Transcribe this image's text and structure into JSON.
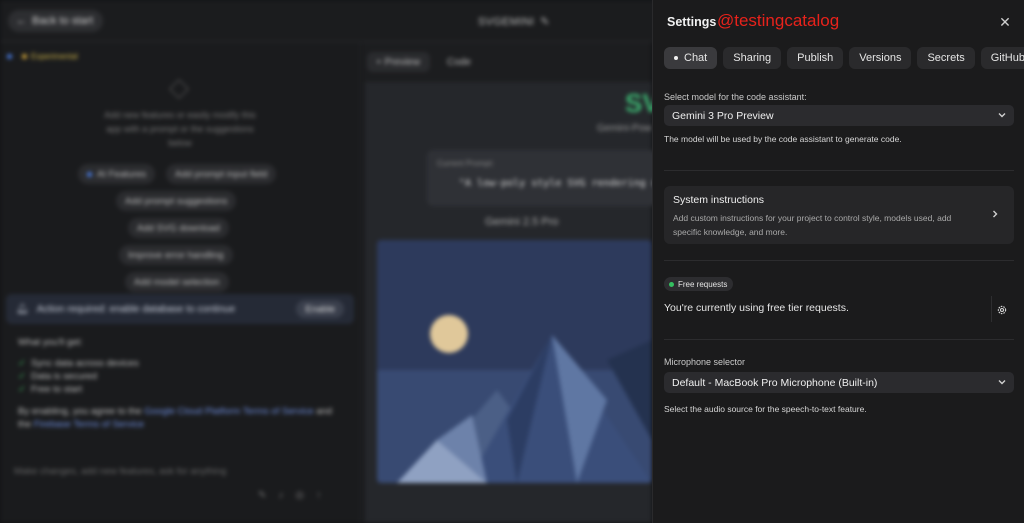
{
  "background": {
    "back_button": "Back to start",
    "app_title": "SVGEMINI",
    "experimental_badge": "Experimental",
    "hint_text": "Add new features or easily modify this app with a prompt or the suggestions below",
    "suggestions": [
      "AI Features",
      "Add prompt input field",
      "Add prompt suggestions",
      "Add SVG download",
      "Improve error handling",
      "Add model selection"
    ],
    "action_required": "Action required: enable database to continue",
    "enable_button": "Enable",
    "what_you_get": "What you'll get:",
    "benefits": [
      "Sync data across devices",
      "Data is secured",
      "Free to start"
    ],
    "terms_prefix": "By enabling, you agree to the",
    "terms_link1": "Google Cloud Platform Terms of Service",
    "terms_and": "and the",
    "terms_link2": "Firebase Terms of Service",
    "compose_placeholder": "Make changes, add new features, ask for anything",
    "tab_preview": "Preview",
    "tab_code": "Code",
    "preview_heading": "SV",
    "preview_subheading": "Gemini-Pow",
    "current_prompt_label": "Current Prompt:",
    "current_prompt_value": "\"A low-poly style SVG rendering o",
    "model_heading": "Gemini 2.5 Pro"
  },
  "settings": {
    "title": "Settings",
    "watermark": "@testingcatalog",
    "tabs": [
      {
        "label": "Chat",
        "active": true
      },
      {
        "label": "Sharing",
        "active": false
      },
      {
        "label": "Publish",
        "active": false
      },
      {
        "label": "Versions",
        "active": false
      },
      {
        "label": "Secrets",
        "active": false
      },
      {
        "label": "GitHub",
        "active": false
      }
    ],
    "model_label": "Select model for the code assistant:",
    "model_value": "Gemini 3 Pro Preview",
    "model_helper": "The model will be used by the code assistant to generate code.",
    "system_title": "System instructions",
    "system_desc": "Add custom instructions for your project to control style, models used, add specific knowledge, and more.",
    "free_badge": "Free requests",
    "free_text": "You're currently using free tier requests.",
    "mic_label": "Microphone selector",
    "mic_value": "Default - MacBook Pro Microphone (Built-in)",
    "mic_helper": "Select the audio source for the speech-to-text feature."
  },
  "icons": [
    "pencil-icon",
    "arrow-left-icon",
    "bell-icon",
    "close-icon",
    "chevron-down-icon",
    "chevron-right-icon",
    "gear-icon"
  ],
  "colors": {
    "accent_green": "#34c060",
    "brand_red": "#e8221b"
  }
}
